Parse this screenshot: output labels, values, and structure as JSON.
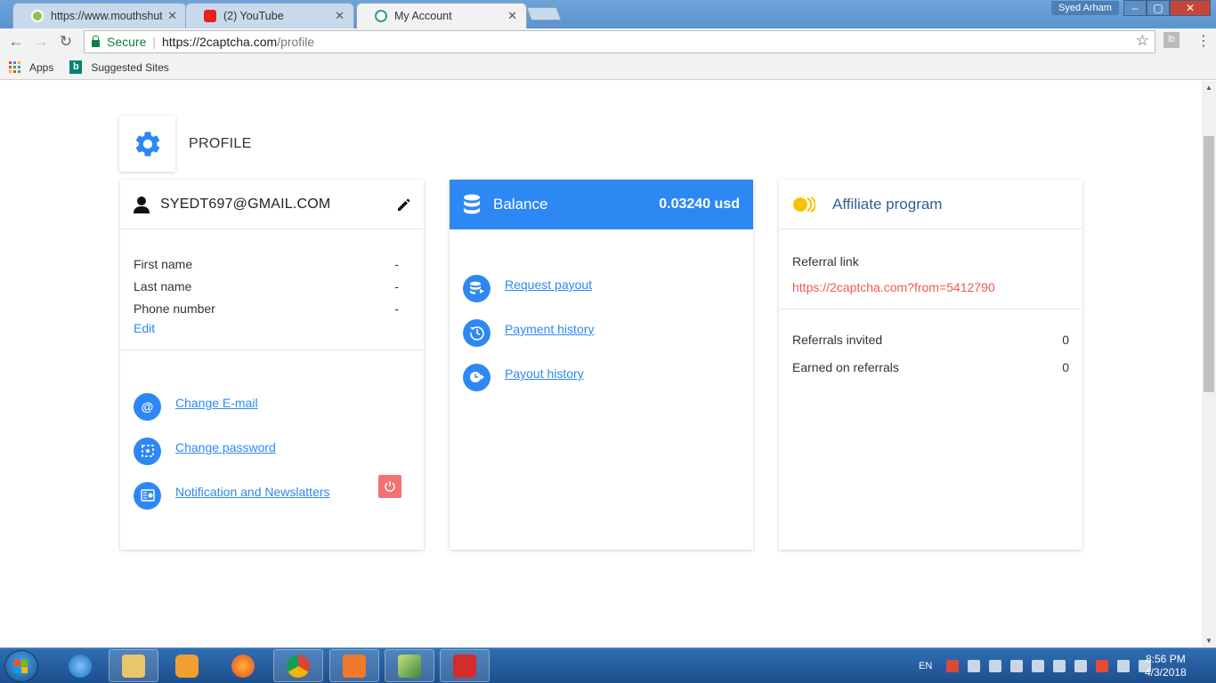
{
  "browser": {
    "tabs": [
      {
        "label": "https://www.mouthshut.c",
        "icon": "mouthshut-favicon-icon",
        "active": false
      },
      {
        "label": "(2) YouTube",
        "icon": "youtube-favicon-icon",
        "active": false
      },
      {
        "label": "My Account",
        "icon": "2captcha-favicon-icon",
        "active": true
      }
    ],
    "user_name": "Syed Arham",
    "secure_label": "Secure",
    "url_host": "https://2captcha.com",
    "url_path": "/profile",
    "bookmarks": {
      "apps": "Apps",
      "suggested": "Suggested Sites"
    }
  },
  "page": {
    "section_title": "PROFILE",
    "account": {
      "email": "SYEDT697@GMAIL.COM",
      "fields": [
        {
          "label": "First name",
          "value": "-"
        },
        {
          "label": "Last name",
          "value": "-"
        },
        {
          "label": "Phone number",
          "value": "-"
        }
      ],
      "edit_label": "Edit",
      "links": [
        {
          "label": "Change E-mail",
          "icon": "at-sign-icon"
        },
        {
          "label": "Change password",
          "icon": "password-icon"
        },
        {
          "label": "Notification and Newslatters",
          "icon": "newsletter-icon"
        }
      ]
    },
    "balance": {
      "title": "Balance",
      "amount": "0.03240 usd",
      "links": [
        {
          "label": "Request payout",
          "icon": "payout-icon"
        },
        {
          "label": "Payment history",
          "icon": "history-icon"
        },
        {
          "label": "Payout history",
          "icon": "payout-history-icon"
        }
      ]
    },
    "affiliate": {
      "title": "Affiliate program",
      "referral_label": "Referral link",
      "referral_link": "https://2captcha.com?from=5412790",
      "stats": [
        {
          "label": "Referrals invited",
          "value": "0"
        },
        {
          "label": "Earned on referrals",
          "value": "0"
        }
      ]
    }
  },
  "taskbar": {
    "language": "EN",
    "time": "8:56 PM",
    "date": "4/3/2018"
  },
  "colors": {
    "accent": "#2d88f4",
    "danger": "#f47171",
    "link_red": "#f05a4f",
    "coin": "#f5c400"
  }
}
